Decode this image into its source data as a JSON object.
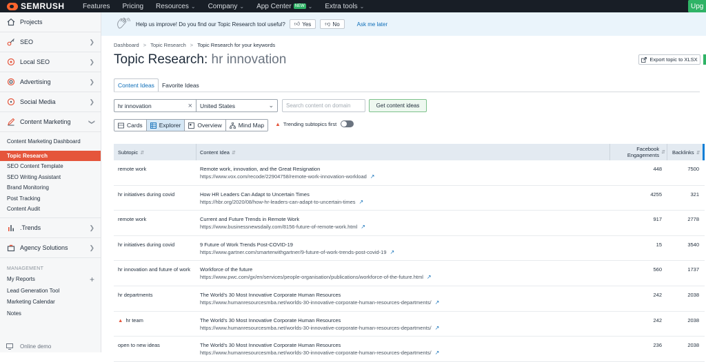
{
  "topbar": {
    "logo": "SEMRUSH",
    "nav": [
      {
        "label": "Features",
        "chevron": false
      },
      {
        "label": "Pricing",
        "chevron": false
      },
      {
        "label": "Resources",
        "chevron": true
      },
      {
        "label": "Company",
        "chevron": true
      },
      {
        "label": "App Center",
        "chevron": true,
        "badge": "NEW"
      },
      {
        "label": "Extra tools",
        "chevron": true
      }
    ],
    "upgrade": "Upg"
  },
  "sidebar": {
    "items": [
      {
        "label": "Projects",
        "icon": "home-icon",
        "arrow": false
      },
      {
        "label": "SEO",
        "icon": "key-icon",
        "arrow": true
      },
      {
        "label": "Local SEO",
        "icon": "pin-icon",
        "arrow": true
      },
      {
        "label": "Advertising",
        "icon": "target-icon",
        "arrow": true
      },
      {
        "label": "Social Media",
        "icon": "chat-icon",
        "arrow": true
      },
      {
        "label": "Content Marketing",
        "icon": "pen-icon",
        "arrow": true,
        "expanded": true
      }
    ],
    "content_marketing_sub": [
      "Content Marketing Dashboard",
      "Topic Research",
      "SEO Content Template",
      "SEO Writing Assistant",
      "Brand Monitoring",
      "Post Tracking",
      "Content Audit"
    ],
    "active_sub": "Topic Research",
    "lower_items": [
      {
        "label": ".Trends",
        "icon": "bars-icon"
      },
      {
        "label": "Agency Solutions",
        "icon": "briefcase-icon"
      }
    ],
    "management_label": "MANAGEMENT",
    "management": [
      "My Reports",
      "Lead Generation Tool",
      "Marketing Calendar",
      "Notes"
    ],
    "online_demo": "Online demo"
  },
  "feedback": {
    "question": "Help us improve! Do you find our Topic Research tool useful?",
    "yes": "Yes",
    "no": "No",
    "later": "Ask me later"
  },
  "breadcrumb": [
    "Dashboard",
    "Topic Research",
    "Topic Research for your keywords"
  ],
  "title": {
    "prefix": "Topic Research:",
    "keyword": "hr innovation"
  },
  "export_label": "Export topic to XLSX",
  "tabs": [
    "Content Ideas",
    "Favorite Ideas"
  ],
  "search": {
    "keyword": "hr innovation",
    "country": "United States",
    "content_placeholder": "Search content on domain",
    "get_ideas": "Get content ideas"
  },
  "views": [
    "Cards",
    "Explorer",
    "Overview",
    "Mind Map"
  ],
  "active_view": "Explorer",
  "trending_label": "Trending subtopics first",
  "table": {
    "headers": {
      "subtopic": "Subtopic",
      "idea": "Content Idea",
      "fb_line1": "Facebook",
      "fb_line2": "Engagements",
      "backlinks": "Backlinks"
    },
    "rows": [
      {
        "subtopic": "remote work",
        "trending": false,
        "idea": "Remote work, innovation, and the Great Resignation",
        "url": "https://www.vox.com/recode/22904758/remote-work-innovation-workload",
        "fb": "448",
        "bl": "7500"
      },
      {
        "subtopic": "hr initiatives during covid",
        "trending": false,
        "idea": "How HR Leaders Can Adapt to Uncertain Times",
        "url": "https://hbr.org/2020/08/how-hr-leaders-can-adapt-to-uncertain-times",
        "fb": "4255",
        "bl": "321"
      },
      {
        "subtopic": "remote work",
        "trending": false,
        "idea": "Current and Future Trends in Remote Work",
        "url": "https://www.businessnewsdaily.com/8156-future-of-remote-work.html",
        "fb": "917",
        "bl": "2778"
      },
      {
        "subtopic": "hr initiatives during covid",
        "trending": false,
        "idea": "9 Future of Work Trends Post-COVID-19",
        "url": "https://www.gartner.com/smarterwithgartner/9-future-of-work-trends-post-covid-19",
        "fb": "15",
        "bl": "3540"
      },
      {
        "subtopic": "hr innovation and future of work",
        "trending": false,
        "idea": "Workforce of the future",
        "url": "https://www.pwc.com/gx/en/services/people-organisation/publications/workforce-of-the-future.html",
        "fb": "560",
        "bl": "1737"
      },
      {
        "subtopic": "hr departments",
        "trending": false,
        "idea": "The World's 30 Most Innovative Corporate Human Resources",
        "url": "https://www.humanresourcesmba.net/worlds-30-innovative-corporate-human-resources-departments/",
        "fb": "242",
        "bl": "2038"
      },
      {
        "subtopic": "hr team",
        "trending": true,
        "idea": "The World's 30 Most Innovative Corporate Human Resources",
        "url": "https://www.humanresourcesmba.net/worlds-30-innovative-corporate-human-resources-departments/",
        "fb": "242",
        "bl": "2038"
      },
      {
        "subtopic": "open to new ideas",
        "trending": false,
        "idea": "The World's 30 Most Innovative Corporate Human Resources",
        "url": "https://www.humanresourcesmba.net/worlds-30-innovative-corporate-human-resources-departments/",
        "fb": "236",
        "bl": "2038"
      }
    ]
  }
}
